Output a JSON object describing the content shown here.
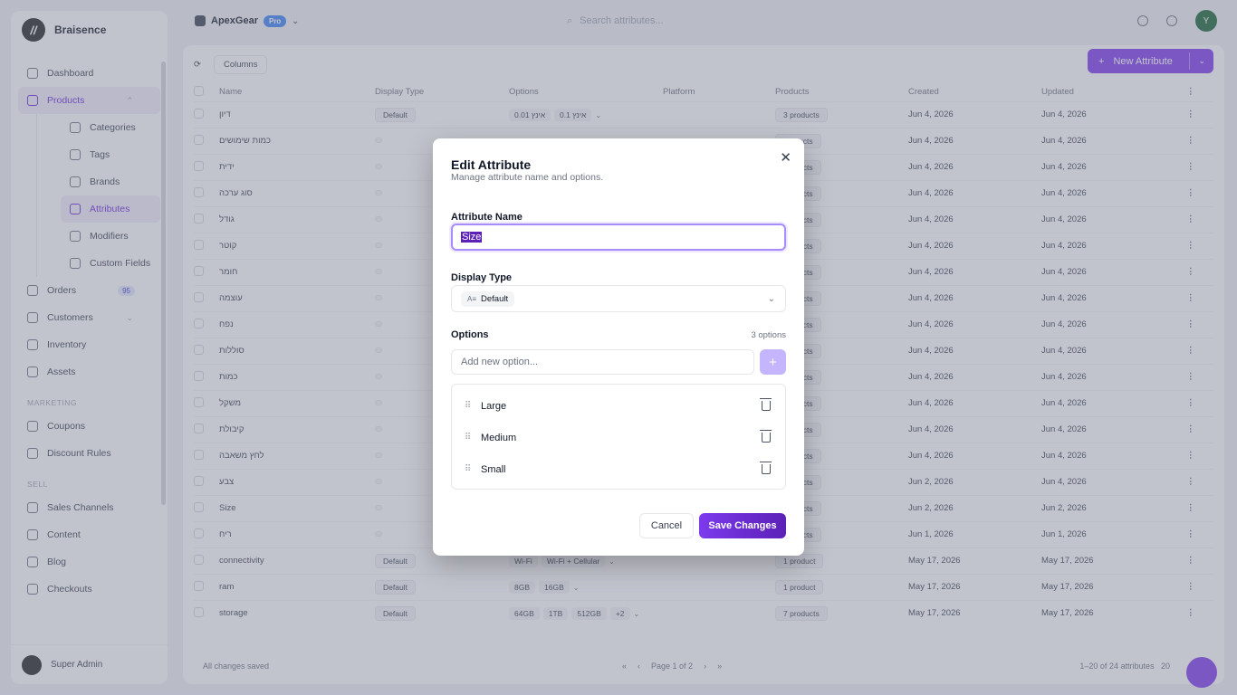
{
  "brand": {
    "name": "Braisence"
  },
  "topbar": {
    "org": "ApexGear",
    "badge": "Pro",
    "search_placeholder": "Search attributes...",
    "user_initial": "Y"
  },
  "sidebar": {
    "items": [
      {
        "label": "Dashboard"
      },
      {
        "label": "Products"
      },
      {
        "label": "Orders",
        "badge": "95"
      },
      {
        "label": "Customers"
      },
      {
        "label": "Inventory"
      },
      {
        "label": "Assets"
      }
    ],
    "product_sub": [
      "Categories",
      "Tags",
      "Brands",
      "Attributes",
      "Modifiers",
      "Custom Fields"
    ],
    "marketing_title": "MARKETING",
    "marketing": [
      "Coupons",
      "Discount Rules"
    ],
    "sell_title": "SELL",
    "sell": [
      "Sales Channels",
      "Content",
      "Blog",
      "Checkouts"
    ],
    "user": "Super Admin"
  },
  "toolbar": {
    "columns": "Columns",
    "new_attribute": "New Attribute"
  },
  "table": {
    "headers": [
      "Name",
      "Display Type",
      "Options",
      "Platform",
      "Products",
      "Created",
      "Updated"
    ],
    "rows": [
      {
        "name": "דיון",
        "type": "Default",
        "options": [
          "0.01 אינץ",
          "0.1 אינץ"
        ],
        "products": "3 products",
        "created": "Jun 4, 2026",
        "updated": "Jun 4, 2026"
      },
      {
        "name": "כמות שימושים",
        "type": "",
        "options": [],
        "products": "products",
        "created": "Jun 4, 2026",
        "updated": "Jun 4, 2026"
      },
      {
        "name": "ידית",
        "type": "",
        "options": [],
        "products": "products",
        "created": "Jun 4, 2026",
        "updated": "Jun 4, 2026"
      },
      {
        "name": "סוג ערכה",
        "type": "",
        "options": [],
        "products": "products",
        "created": "Jun 4, 2026",
        "updated": "Jun 4, 2026"
      },
      {
        "name": "גודל",
        "type": "",
        "options": [],
        "products": "products",
        "created": "Jun 4, 2026",
        "updated": "Jun 4, 2026"
      },
      {
        "name": "קוטר",
        "type": "",
        "options": [],
        "products": "products",
        "created": "Jun 4, 2026",
        "updated": "Jun 4, 2026"
      },
      {
        "name": "חומר",
        "type": "",
        "options": [],
        "products": "products",
        "created": "Jun 4, 2026",
        "updated": "Jun 4, 2026"
      },
      {
        "name": "עוצמה",
        "type": "",
        "options": [],
        "products": "products",
        "created": "Jun 4, 2026",
        "updated": "Jun 4, 2026"
      },
      {
        "name": "נפח",
        "type": "",
        "options": [],
        "products": "products",
        "created": "Jun 4, 2026",
        "updated": "Jun 4, 2026"
      },
      {
        "name": "סוללות",
        "type": "",
        "options": [],
        "products": "products",
        "created": "Jun 4, 2026",
        "updated": "Jun 4, 2026"
      },
      {
        "name": "כמות",
        "type": "",
        "options": [],
        "products": "products",
        "created": "Jun 4, 2026",
        "updated": "Jun 4, 2026"
      },
      {
        "name": "משקל",
        "type": "",
        "options": [],
        "products": "products",
        "created": "Jun 4, 2026",
        "updated": "Jun 4, 2026"
      },
      {
        "name": "קיבולת",
        "type": "",
        "options": [],
        "products": "products",
        "created": "Jun 4, 2026",
        "updated": "Jun 4, 2026"
      },
      {
        "name": "לחץ משאבה",
        "type": "",
        "options": [],
        "products": "products",
        "created": "Jun 4, 2026",
        "updated": "Jun 4, 2026"
      },
      {
        "name": "צבע",
        "type": "",
        "options": [],
        "products": "products",
        "created": "Jun 2, 2026",
        "updated": "Jun 4, 2026"
      },
      {
        "name": "Size",
        "type": "",
        "options": [],
        "products": "products",
        "created": "Jun 2, 2026",
        "updated": "Jun 2, 2026"
      },
      {
        "name": "ריח",
        "type": "",
        "options": [],
        "products": "products",
        "created": "Jun 1, 2026",
        "updated": "Jun 1, 2026"
      },
      {
        "name": "connectivity",
        "type": "Default",
        "options": [
          "Wi-Fi",
          "Wi-Fi + Cellular"
        ],
        "products": "1 product",
        "created": "May 17, 2026",
        "updated": "May 17, 2026"
      },
      {
        "name": "ram",
        "type": "Default",
        "options": [
          "8GB",
          "16GB"
        ],
        "products": "1 product",
        "created": "May 17, 2026",
        "updated": "May 17, 2026"
      },
      {
        "name": "storage",
        "type": "Default",
        "options": [
          "64GB",
          "1TB",
          "512GB",
          "+2"
        ],
        "products": "7 products",
        "created": "May 17, 2026",
        "updated": "May 17, 2026"
      }
    ]
  },
  "footer": {
    "saved": "All changes saved",
    "page": "Page 1 of 2",
    "count": "1–20 of 24 attributes",
    "per_page": "20"
  },
  "modal": {
    "title": "Edit Attribute",
    "subtitle": "Manage attribute name and options.",
    "name_label": "Attribute Name",
    "name_value": "Size",
    "display_label": "Display Type",
    "display_value": "Default",
    "options_label": "Options",
    "options_count": "3 options",
    "add_placeholder": "Add new option...",
    "options": [
      {
        "label": "Large"
      },
      {
        "label": "Medium"
      },
      {
        "label": "Small"
      }
    ],
    "cancel": "Cancel",
    "save": "Save Changes"
  },
  "colors": {
    "accent": "#7c3aed",
    "overlay": "rgba(120,125,145,.45)"
  }
}
